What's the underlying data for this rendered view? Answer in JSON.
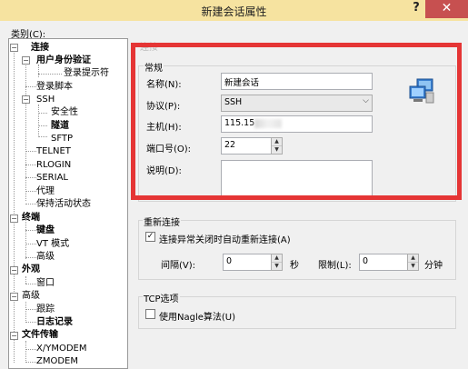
{
  "window": {
    "title": "新建会话属性",
    "help": "?",
    "close": "✕"
  },
  "category_label": "类别(C):",
  "tree": [
    {
      "label": "连接",
      "bold": true,
      "exp": "−"
    },
    {
      "label": "用户身份验证",
      "bold": true,
      "exp": "−"
    },
    {
      "label": "登录提示符",
      "bold": false
    },
    {
      "label": "登录脚本",
      "bold": false
    },
    {
      "label": "SSH",
      "bold": false,
      "exp": "−"
    },
    {
      "label": "安全性",
      "bold": false
    },
    {
      "label": "隧道",
      "bold": true
    },
    {
      "label": "SFTP",
      "bold": false
    },
    {
      "label": "TELNET",
      "bold": false
    },
    {
      "label": "RLOGIN",
      "bold": false
    },
    {
      "label": "SERIAL",
      "bold": false
    },
    {
      "label": "代理",
      "bold": false
    },
    {
      "label": "保持活动状态",
      "bold": false
    },
    {
      "label": "终端",
      "bold": true,
      "exp": "−"
    },
    {
      "label": "键盘",
      "bold": true
    },
    {
      "label": "VT 模式",
      "bold": false
    },
    {
      "label": "高级",
      "bold": false
    },
    {
      "label": "外观",
      "bold": true,
      "exp": "−"
    },
    {
      "label": "窗口",
      "bold": false
    },
    {
      "label": "高级",
      "bold": false,
      "exp": "−"
    },
    {
      "label": "跟踪",
      "bold": false
    },
    {
      "label": "日志记录",
      "bold": true
    },
    {
      "label": "文件传输",
      "bold": true,
      "exp": "−"
    },
    {
      "label": "X/YMODEM",
      "bold": false
    },
    {
      "label": "ZMODEM",
      "bold": false
    }
  ],
  "panel": {
    "ghost_heading": "连接",
    "general": {
      "legend": "常规",
      "name_label": "名称(N):",
      "name_value": "新建会话",
      "protocol_label": "协议(P):",
      "protocol_value": "SSH",
      "host_label": "主机(H):",
      "host_value": "115.15",
      "port_label": "端口号(O):",
      "port_value": "22",
      "desc_label": "说明(D):",
      "desc_value": ""
    },
    "reconnect": {
      "legend": "重新连接",
      "checkbox_label": "连接异常关闭时自动重新连接(A)",
      "checked": true,
      "interval_label": "间隔(V):",
      "interval_value": "0",
      "interval_unit": "秒",
      "limit_label": "限制(L):",
      "limit_value": "0",
      "limit_unit": "分钟"
    },
    "tcp": {
      "legend": "TCP选项",
      "nagle_label": "使用Nagle算法(U)",
      "checked": false
    }
  },
  "colors": {
    "highlight_box": "#e53535",
    "titlebar": "#f6e3a0",
    "close": "#c75050"
  },
  "icons": {
    "session": "network-computers-icon"
  }
}
